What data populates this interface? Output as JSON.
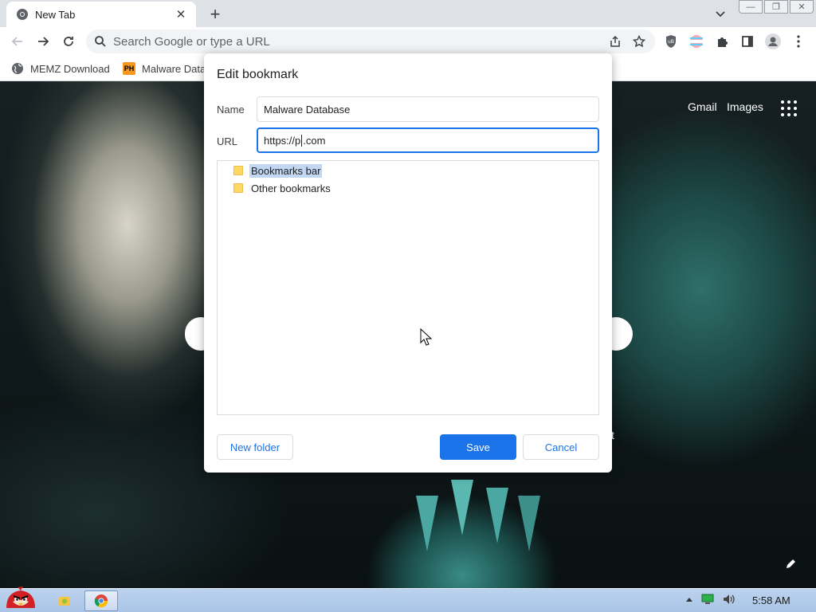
{
  "browser": {
    "tab": {
      "title": "New Tab"
    },
    "omnibox": {
      "placeholder": "Search Google or type a URL"
    },
    "bookmarks_bar": [
      {
        "label": "MEMZ Download"
      },
      {
        "label": "Malware Data",
        "badge": "PH"
      }
    ]
  },
  "page": {
    "links": {
      "gmail": "Gmail",
      "images": "Images"
    },
    "partial_text": "t"
  },
  "dialog": {
    "title": "Edit bookmark",
    "name_label": "Name",
    "name_value": "Malware Database",
    "url_label": "URL",
    "url_before_caret": "https://p",
    "url_after_caret": ".com",
    "folders": [
      {
        "label": "Bookmarks bar",
        "selected": true
      },
      {
        "label": "Other bookmarks",
        "selected": false
      }
    ],
    "buttons": {
      "new_folder": "New folder",
      "save": "Save",
      "cancel": "Cancel"
    }
  },
  "taskbar": {
    "clock": "5:58 AM"
  },
  "colors": {
    "accent": "#1a73e8",
    "selection": "#c2d7f2",
    "folder": "#fdd663"
  }
}
